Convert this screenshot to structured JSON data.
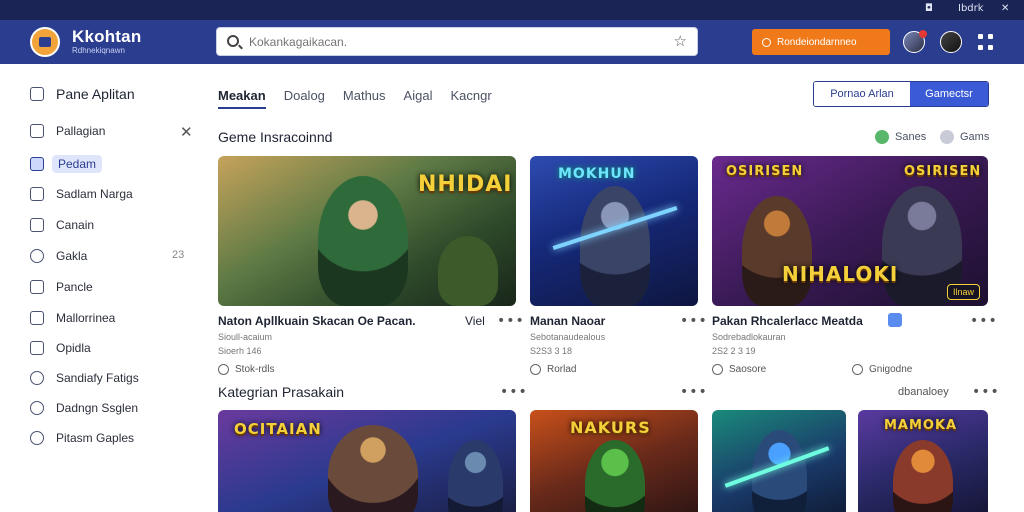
{
  "topbar": {
    "item1": "◘",
    "item2": "Ibdrk",
    "item3": "✕"
  },
  "header": {
    "brand": "Kkohtan",
    "brand_sub": "Rdhnekiqnawn",
    "search_placeholder": "Kokankagaikacan.",
    "star_icon": "☆",
    "cta_label": "Rondeiondarnneo"
  },
  "sidebar": {
    "items": [
      {
        "label": "Pane Aplitan"
      },
      {
        "label": "Pallagian"
      },
      {
        "label": "Pedam"
      },
      {
        "label": "Sadlam Narga"
      },
      {
        "label": "Canain"
      },
      {
        "label": "Gakla"
      },
      {
        "label": "Pancle"
      },
      {
        "label": "Mallorrinea"
      },
      {
        "label": "Opidla"
      },
      {
        "label": "Sandiafy Fatigs"
      },
      {
        "label": "Dadngn Ssglen"
      },
      {
        "label": "Pitasm Gaples"
      }
    ],
    "close_icon": "✕",
    "count": "23"
  },
  "tabs": [
    "Meakan",
    "Doalog",
    "Mathus",
    "Aigal",
    "Kacngr"
  ],
  "segment": {
    "left": "Pornao Arlan",
    "right": "Gamectsr"
  },
  "section1": {
    "title": "Geme Insracoinnd",
    "chip1": "Sanes",
    "chip2": "Gams"
  },
  "cards_row1": [
    {
      "banner": "NHIDAI",
      "title": "Naton Apllkuain Skacan Oe Pacan.",
      "extra": "Viel",
      "meta": "Sioull-acaium",
      "meta2": "Sioerh 146",
      "foot": "Stok-rdls"
    },
    {
      "banner": "MOKHUN",
      "title": "Manan Naoar",
      "extra": "",
      "meta": "Sebotanaudealous",
      "meta2": "S2S3 3 18",
      "foot": "Rorlad"
    },
    {
      "banner": "OSIRISEN",
      "banner2": "NIHALOKI",
      "badge": "Ilnaw",
      "title": "Pakan Rhcalerlacc Meatda",
      "extra": "",
      "meta": "Sodrebadlokauran",
      "meta2": "2S2 2 3 19",
      "foot": "Saosore",
      "foot2": "Gnigodne"
    }
  ],
  "section2": {
    "title": "Kategrian Prasakain",
    "side": "dbanaloey"
  },
  "cards_row2": [
    {
      "banner": "OCITAIAN"
    },
    {
      "banner": "NAKURS"
    },
    {
      "banner": ""
    },
    {
      "banner": "MAMOKA"
    }
  ],
  "more_icon": "•••",
  "colors": {
    "header": "#2b3d8f",
    "accent": "#f07a1a",
    "active": "#3b5bd6"
  }
}
